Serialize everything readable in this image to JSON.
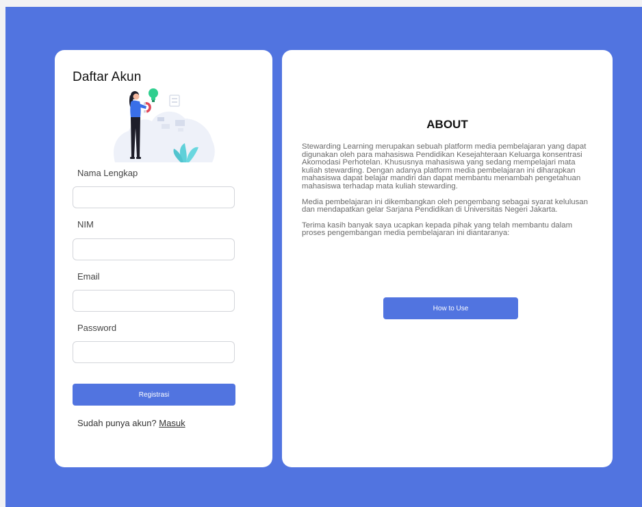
{
  "register": {
    "title": "Daftar Akun",
    "fields": [
      {
        "label": "Nama Lengkap",
        "value": "",
        "placeholder": ""
      },
      {
        "label": "NIM",
        "value": "",
        "placeholder": ""
      },
      {
        "label": "Email",
        "value": "",
        "placeholder": ""
      },
      {
        "label": "Password",
        "value": "",
        "placeholder": ""
      }
    ],
    "submit_label": "Registrasi",
    "login_prompt": "Sudah punya akun?",
    "login_link": "Masuk"
  },
  "about": {
    "title": "ABOUT",
    "paragraphs": [
      "Stewarding Learning merupakan sebuah platform media pembelajaran yang dapat digunakan oleh para mahasiswa Pendidikan Kesejahteraan Keluarga konsentrasi Akomodasi Perhotelan. Khususnya mahasiswa yang sedang mempelajari mata kuliah stewarding. Dengan adanya platform media pembelajaran ini diharapkan mahasiswa dapat belajar mandiri dan dapat membantu menambah pengetahuan mahasiswa terhadap mata kuliah stewarding.",
      "Media pembelajaran ini dikembangkan oleh pengembang sebagai syarat kelulusan dan mendapatkan gelar Sarjana Pendidikan di Universitas Negeri Jakarta.",
      "Terima kasih banyak saya ucapkan kepada pihak yang telah membantu dalam proses pengembangan media pembelajaran ini diantaranya:"
    ],
    "button_label": "How to Use"
  },
  "colors": {
    "primary": "#5174e0",
    "card": "#ffffff",
    "outer": "#f2f2f4"
  },
  "icons": {
    "illustration": "person-with-lightbulb-and-magnet-illustration"
  }
}
